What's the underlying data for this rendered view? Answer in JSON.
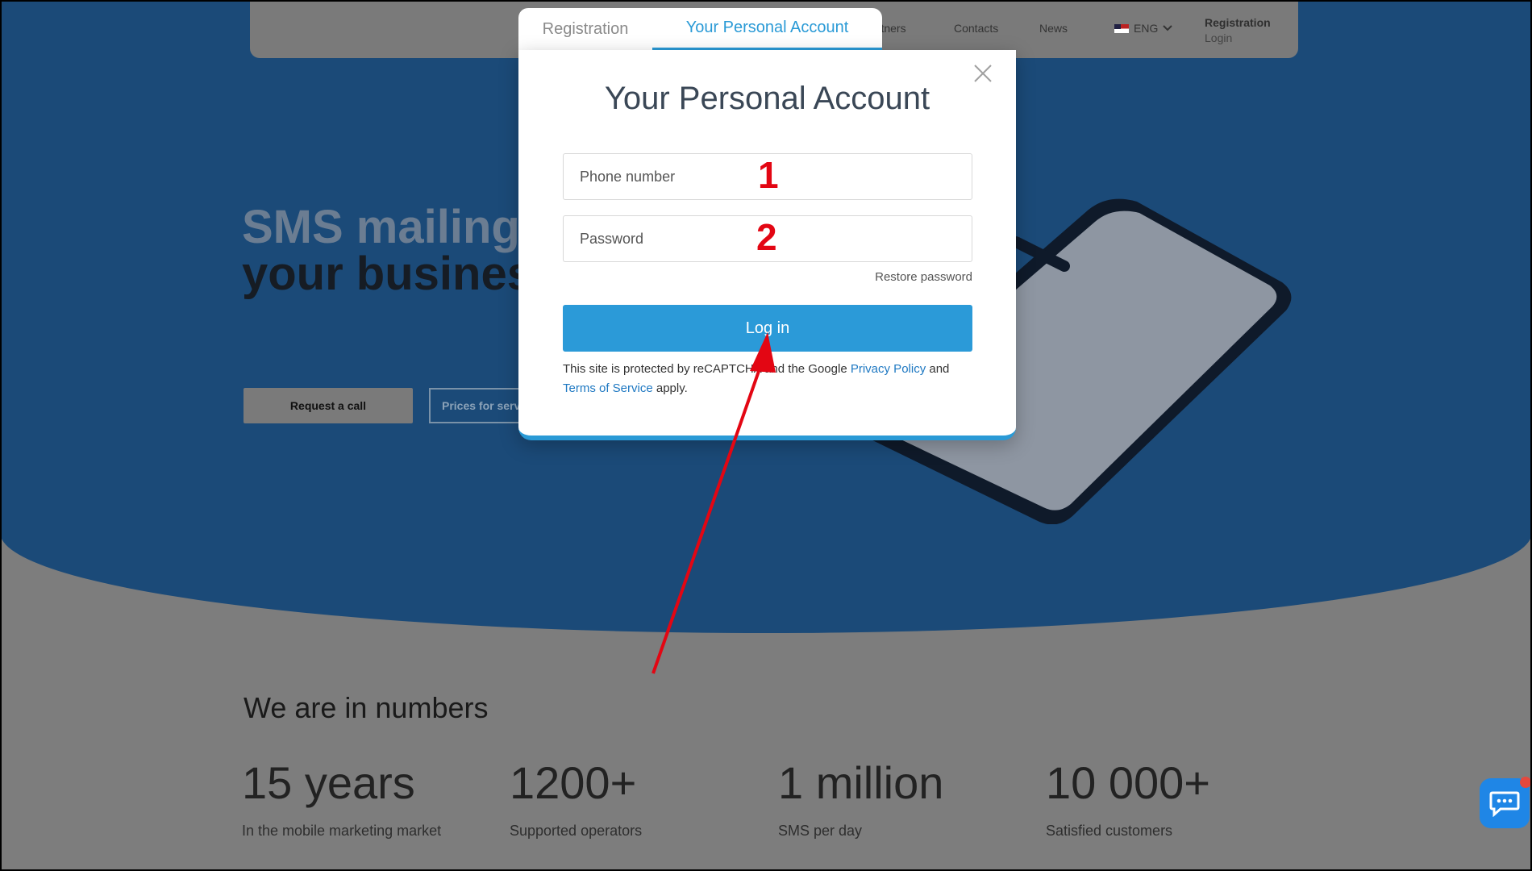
{
  "nav": {
    "links": [
      "artners",
      "Contacts",
      "News"
    ],
    "language": "ENG",
    "registration": "Registration",
    "login": "Login"
  },
  "hero": {
    "title_line1": "SMS mailings",
    "title_line2": "your business",
    "request_call": "Request a call",
    "prices": "Prices for services"
  },
  "modal": {
    "tabs": [
      "Registration",
      "Your Personal Account"
    ],
    "active_tab": "Your Personal Account",
    "title": "Your Personal Account",
    "phone_placeholder": "Phone number",
    "password_placeholder": "Password",
    "restore": "Restore password",
    "login_button": "Log in",
    "recaptcha": {
      "text_before": "This site is protected by reCAPTCHA and the Google",
      "privacy": "Privacy Policy",
      "and": "and",
      "terms": "Terms of Service",
      "apply": "apply."
    }
  },
  "annotations": {
    "marker1": "1",
    "marker2": "2",
    "arrow_color": "#e30613"
  },
  "numbers": {
    "title": "We are in numbers",
    "stats": [
      {
        "value": "15 years",
        "label": "In the mobile marketing market"
      },
      {
        "value": "1200+",
        "label": "Supported operators"
      },
      {
        "value": "1 million",
        "label": "SMS per day"
      },
      {
        "value": "10 000+",
        "label": "Satisfied customers"
      }
    ]
  },
  "colors": {
    "accent": "#2a9ad6",
    "hero_bg": "#1b4a78",
    "overlay": "#7d7d7d"
  },
  "icons": {
    "close": "close-icon",
    "chevron": "chevron-down-icon",
    "chat": "chat-icon",
    "flag": "us-flag-icon"
  }
}
